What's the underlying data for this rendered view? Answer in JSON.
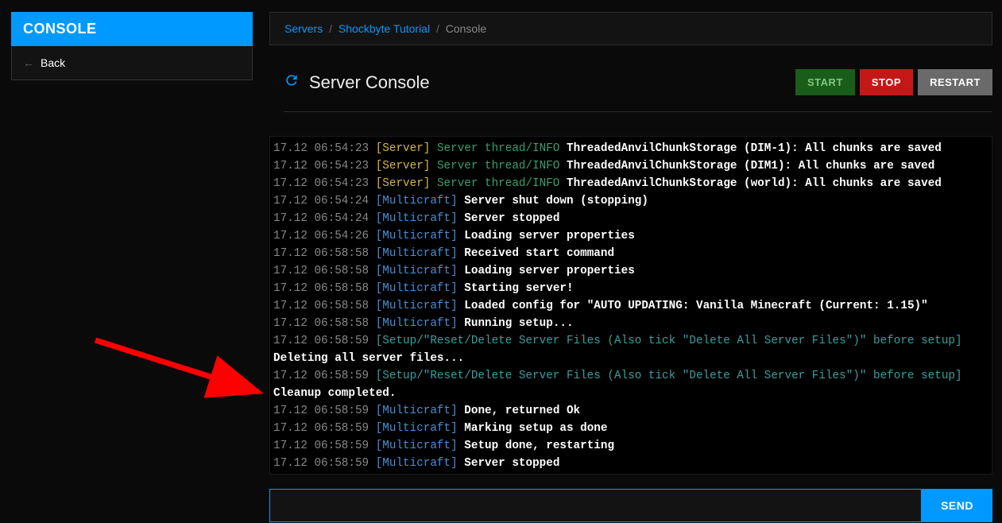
{
  "sidebar": {
    "title": "CONSOLE",
    "back_label": "Back"
  },
  "breadcrumb": {
    "servers": "Servers",
    "server_name": "Shockbyte Tutorial",
    "current": "Console"
  },
  "header": {
    "title": "Server Console",
    "start_label": "START",
    "stop_label": "STOP",
    "restart_label": "RESTART"
  },
  "command": {
    "send_label": "SEND",
    "input_value": ""
  },
  "log_lines": [
    {
      "ts": "17.12 06:54:23",
      "tag": "[Server]",
      "tagClass": "tag-server",
      "thread": "Server thread/INFO",
      "msg": "ThreadedAnvilChunkStorage (world): All chunks are saved"
    },
    {
      "ts": "17.12 06:54:23",
      "tag": "[Server]",
      "tagClass": "tag-server",
      "thread": "Server thread/INFO",
      "msg": "ThreadedAnvilChunkStorage (DIM-1): All chunks are saved"
    },
    {
      "ts": "17.12 06:54:23",
      "tag": "[Server]",
      "tagClass": "tag-server",
      "thread": "Server thread/INFO",
      "msg": "ThreadedAnvilChunkStorage (DIM1): All chunks are saved"
    },
    {
      "ts": "17.12 06:54:23",
      "tag": "[Server]",
      "tagClass": "tag-server",
      "thread": "Server thread/INFO",
      "msg": "ThreadedAnvilChunkStorage (world): All chunks are saved"
    },
    {
      "ts": "17.12 06:54:24",
      "tag": "[Multicraft]",
      "tagClass": "tag-multicraft",
      "thread": "",
      "msg": "Server shut down (stopping)"
    },
    {
      "ts": "17.12 06:54:24",
      "tag": "[Multicraft]",
      "tagClass": "tag-multicraft",
      "thread": "",
      "msg": "Server stopped"
    },
    {
      "ts": "17.12 06:54:26",
      "tag": "[Multicraft]",
      "tagClass": "tag-multicraft",
      "thread": "",
      "msg": "Loading server properties"
    },
    {
      "ts": "17.12 06:58:58",
      "tag": "[Multicraft]",
      "tagClass": "tag-multicraft",
      "thread": "",
      "msg": "Received start command"
    },
    {
      "ts": "17.12 06:58:58",
      "tag": "[Multicraft]",
      "tagClass": "tag-multicraft",
      "thread": "",
      "msg": "Loading server properties"
    },
    {
      "ts": "17.12 06:58:58",
      "tag": "[Multicraft]",
      "tagClass": "tag-multicraft",
      "thread": "",
      "msg": "Starting server!"
    },
    {
      "ts": "17.12 06:58:58",
      "tag": "[Multicraft]",
      "tagClass": "tag-multicraft",
      "thread": "",
      "msg": "Loaded config for \"AUTO UPDATING: Vanilla Minecraft (Current: 1.15)\""
    },
    {
      "ts": "17.12 06:58:58",
      "tag": "[Multicraft]",
      "tagClass": "tag-multicraft",
      "thread": "",
      "msg": "Running setup..."
    },
    {
      "ts": "17.12 06:58:59",
      "tag": "[Setup/\"Reset/Delete Server Files (Also tick \"Delete All Server Files\")\" before setup]",
      "tagClass": "tag-setup",
      "thread": "",
      "msg": ""
    },
    {
      "ts": "",
      "tag": "",
      "tagClass": "",
      "thread": "",
      "msg": "Deleting all server files..."
    },
    {
      "ts": "17.12 06:58:59",
      "tag": "[Setup/\"Reset/Delete Server Files (Also tick \"Delete All Server Files\")\" before setup]",
      "tagClass": "tag-setup",
      "thread": "",
      "msg": ""
    },
    {
      "ts": "",
      "tag": "",
      "tagClass": "",
      "thread": "",
      "msg": "Cleanup completed."
    },
    {
      "ts": "17.12 06:58:59",
      "tag": "[Multicraft]",
      "tagClass": "tag-multicraft",
      "thread": "",
      "msg": "Done, returned Ok"
    },
    {
      "ts": "17.12 06:58:59",
      "tag": "[Multicraft]",
      "tagClass": "tag-multicraft",
      "thread": "",
      "msg": "Marking setup as done"
    },
    {
      "ts": "17.12 06:58:59",
      "tag": "[Multicraft]",
      "tagClass": "tag-multicraft",
      "thread": "",
      "msg": "Setup done, restarting"
    },
    {
      "ts": "17.12 06:58:59",
      "tag": "[Multicraft]",
      "tagClass": "tag-multicraft",
      "thread": "",
      "msg": "Server stopped"
    }
  ]
}
